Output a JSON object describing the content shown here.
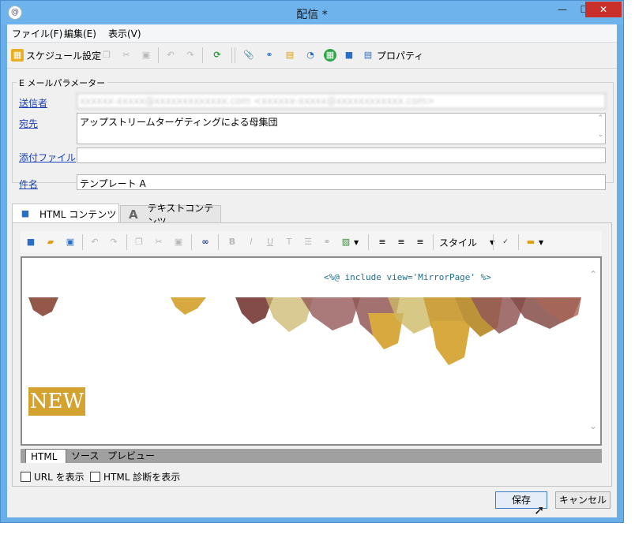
{
  "window": {
    "title": "配信 *",
    "min_glyph": "—",
    "max_glyph": "☐",
    "close_glyph": "✕"
  },
  "menu": [
    "ファイル(F)",
    "編集(E)",
    "表示(V)"
  ],
  "toolbar": {
    "schedule_label": "スケジュール設定",
    "properties_label": "プロパティ"
  },
  "params": {
    "legend": "E メールパラメーター",
    "sender_label": "送信者",
    "sender_value": "xxxxxx-xxxxx@xxxxxxxxxxxxx.com  <xxxxxx-xxxxx@xxxxxxxxxxxx.com>",
    "recipient_label": "宛先",
    "recipient_value": "アップストリームターゲティングによる母集団",
    "attachment_label": "添付ファイル",
    "attachment_value": "",
    "subject_label": "件名",
    "subject_value": "テンプレート A"
  },
  "tabs": {
    "html": "HTML コンテンツ",
    "text": "テキストコンテンツ",
    "text_icon": "A"
  },
  "editor": {
    "style_label": "スタイル",
    "code_line": "<%@ include view='MirrorPage' %>",
    "new_badge": "NEW"
  },
  "view_tabs": [
    "HTML",
    "ソース",
    "プレビュー"
  ],
  "options": {
    "show_url": "URL を表示",
    "show_diagnostics": "HTML 診断を表示"
  },
  "buttons": {
    "save": "保存",
    "cancel": "キャンセル"
  },
  "colors": {
    "title_bar": "#6fb3ec",
    "link": "#1a3fb8",
    "badge": "#d4a22e"
  }
}
